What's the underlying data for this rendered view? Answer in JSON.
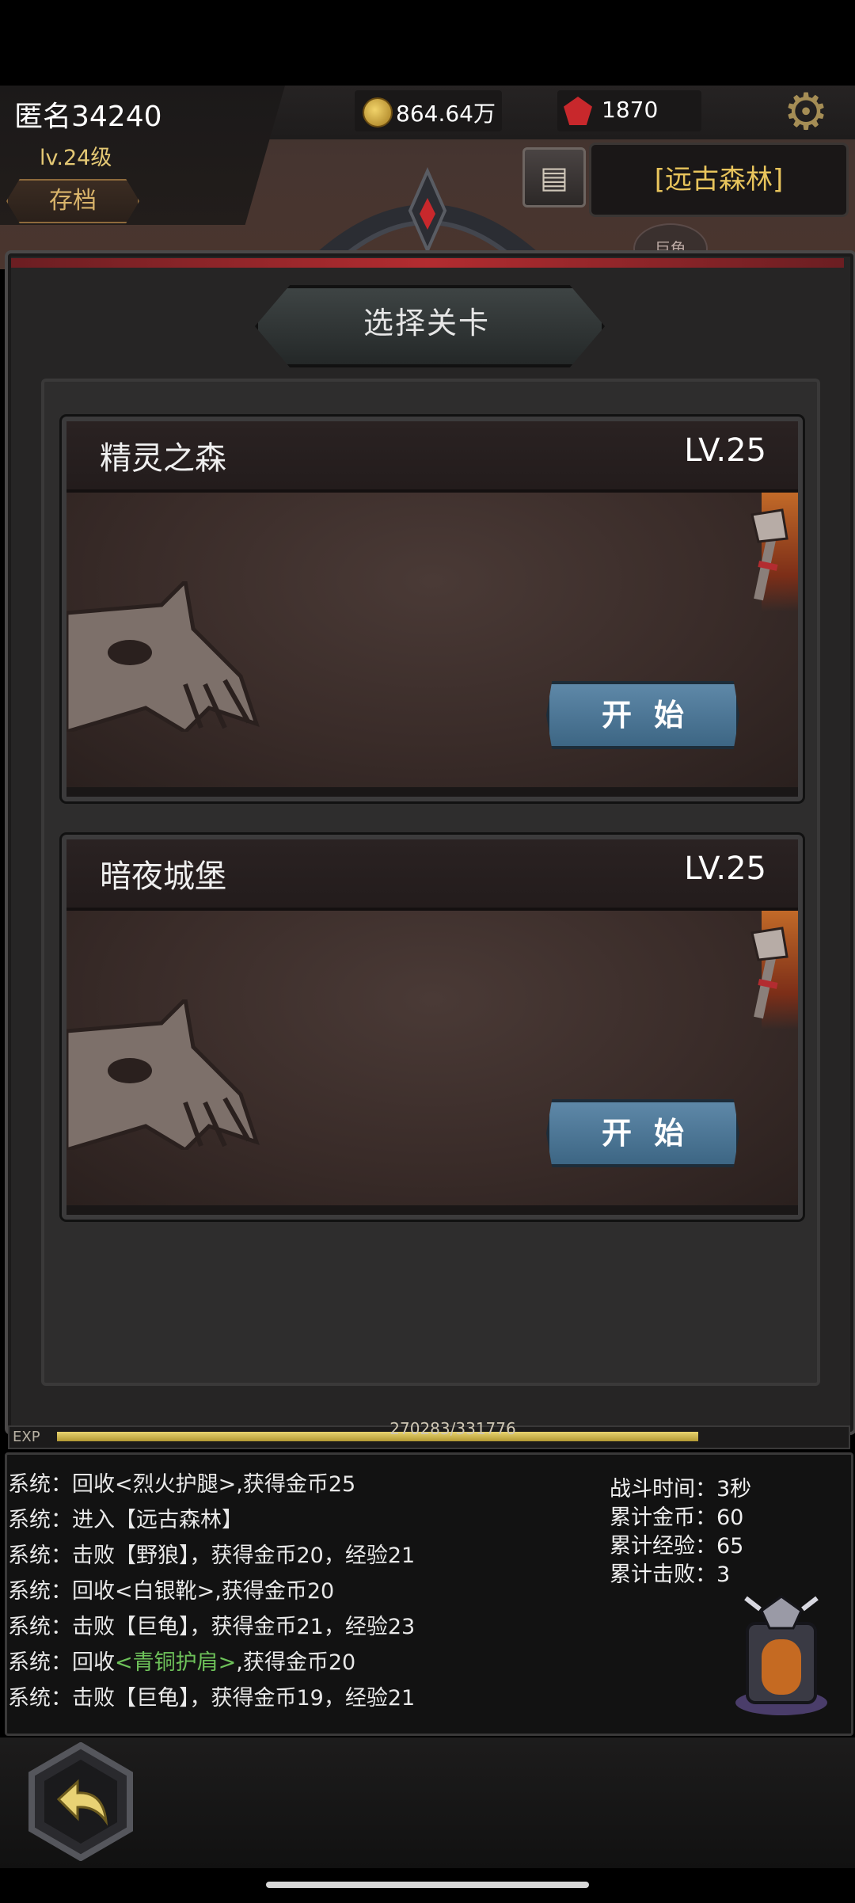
{
  "header": {
    "player_name": "匿名34240",
    "player_level": "lv.24级",
    "save_label": "存档",
    "gold": "864.64万",
    "gems": "1870",
    "location": "[远古森林]",
    "mini_enemy": "巨龟",
    "icons": {
      "gold": "gold-coin-icon",
      "gem": "red-gem-icon",
      "settings": "gear-icon",
      "bag": "inventory-icon"
    }
  },
  "dialog": {
    "title": "选择关卡",
    "stages": [
      {
        "name": "精灵之森",
        "level": "LV.25",
        "button": "开始"
      },
      {
        "name": "暗夜城堡",
        "level": "LV.25",
        "button": "开始"
      }
    ]
  },
  "exp": {
    "label": "EXP",
    "text": "270283/331776",
    "progress": 0.81
  },
  "log": {
    "lines": [
      {
        "prefix": "系统：",
        "text": "回收<烈火护腿>,获得金币25"
      },
      {
        "prefix": "系统：",
        "text": "进入【远古森林】"
      },
      {
        "prefix": "系统：",
        "text": "击败【野狼】，获得金币20，经验21"
      },
      {
        "prefix": "系统：",
        "text": "回收<白银靴>,获得金币20"
      },
      {
        "prefix": "系统：",
        "text": "击败【巨龟】，获得金币21，经验23"
      },
      {
        "prefix": "系统：",
        "text_before": "回收",
        "item": "<青铜护肩>",
        "text_after": ",获得金币20"
      },
      {
        "prefix": "系统：",
        "text": "击败【巨龟】，获得金币19，经验21"
      }
    ],
    "stats": [
      {
        "label": "战斗时间：",
        "value": "3秒"
      },
      {
        "label": "累计金币：",
        "value": "60"
      },
      {
        "label": "累计经验：",
        "value": "65"
      },
      {
        "label": "累计击败：",
        "value": "3"
      }
    ]
  },
  "colors": {
    "accent_gold": "#e8c45c",
    "item_green": "#6ec25a",
    "button_blue": "#4f7898",
    "panel_red": "#b32c30"
  }
}
